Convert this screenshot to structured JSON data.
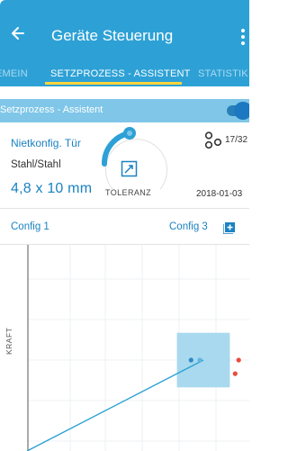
{
  "header": {
    "title": "Geräte Steuerung",
    "back_icon": "arrow-left-icon",
    "menu_icon": "more-vertical-icon"
  },
  "tabs": [
    {
      "label": "EMEIN",
      "active": false
    },
    {
      "label": "SETZPROZESS - ASSISTENT",
      "active": true
    },
    {
      "label": "STATISTIK",
      "active": false
    }
  ],
  "subbar": {
    "label": "Setzprozess - Assistent",
    "toggle_on": true
  },
  "card": {
    "name": "Nietkonfig. Tür",
    "material": "Stahl/Stahl",
    "size": "4,8 x 10 mm",
    "tolerance_label": "TOLERANZ",
    "count": "17/32",
    "date": "2018-01-03"
  },
  "configs": {
    "items": [
      "Config 1",
      "Config 3"
    ],
    "add_icon": "add-box-icon"
  },
  "chart_data": {
    "type": "line",
    "ylabel": "KRAFT",
    "xlabel": "",
    "series": [
      {
        "values": [
          [
            0,
            0
          ],
          [
            1,
            1
          ]
        ]
      }
    ],
    "tolerance_window": {
      "x": [
        0.85,
        1.15
      ],
      "y": [
        0.7,
        1.3
      ]
    },
    "in_points": [
      [
        0.93,
        1.0
      ]
    ],
    "out_points": [
      [
        1.2,
        1.0
      ],
      [
        1.18,
        0.85
      ]
    ],
    "colors": {
      "line": "#2ba1d2",
      "window": "#a8d9ee",
      "in": "#2f89c5",
      "out": "#e74c3c"
    }
  },
  "colors": {
    "header": "#2da1d6",
    "subbar": "#7fc6e8",
    "accent": "#1b82c2",
    "indicator": "#ffd43b"
  }
}
